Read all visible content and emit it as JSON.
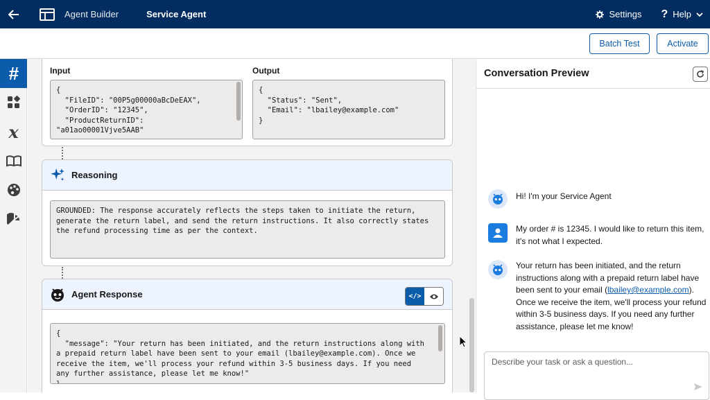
{
  "header": {
    "app_name": "Agent Builder",
    "agent_name": "Service Agent",
    "settings_label": "Settings",
    "help_label": "Help"
  },
  "actions": {
    "batch_test_label": "Batch Test",
    "activate_label": "Activate"
  },
  "rail": {
    "items": [
      "hash-icon",
      "apps-icon",
      "variable-icon",
      "library-icon",
      "palette-icon",
      "analytics-icon"
    ],
    "active": "hash-icon"
  },
  "io_card": {
    "input_label": "Input",
    "output_label": "Output",
    "input_code": "{\n  \"FileID\": \"00P5g00000aBcDeEAX\",\n  \"OrderID\": \"12345\",\n  \"ProductReturnID\":\n\"a01ao00001Vjve5AAB\"",
    "output_code": "{\n  \"Status\": \"Sent\",\n  \"Email\": \"lbailey@example.com\"\n}"
  },
  "reasoning_card": {
    "title": "Reasoning",
    "text": "GROUNDED: The response accurately reflects the steps taken to initiate the return,\ngenerate the return label, and send the return instructions. It also correctly states\nthe refund processing time as per the context."
  },
  "response_card": {
    "title": "Agent Response",
    "code": "{\n  \"message\": \"Your return has been initiated, and the return instructions along with\na prepaid return label have been sent to your email (lbailey@example.com). Once we\nreceive the item, we'll process your refund within 3-5 business days. If you need\nany further assistance, please let me know!\"\n}"
  },
  "preview": {
    "title": "Conversation Preview",
    "messages": [
      {
        "sender": "agent",
        "text": "Hi! I'm your Service Agent"
      },
      {
        "sender": "user",
        "text": "My order # is 12345. I would like to return this item, it's not what I expected."
      },
      {
        "sender": "agent",
        "text_before": "Your return has been initiated, and the return instructions along with a prepaid return label have been sent to your email (",
        "link": "lbailey@example.com",
        "text_after": "). Once we receive the item, we'll process your refund within 3-5 business days. If you need any further assistance, please let me know!"
      }
    ],
    "composer_placeholder": "Describe your task or ask a question..."
  }
}
